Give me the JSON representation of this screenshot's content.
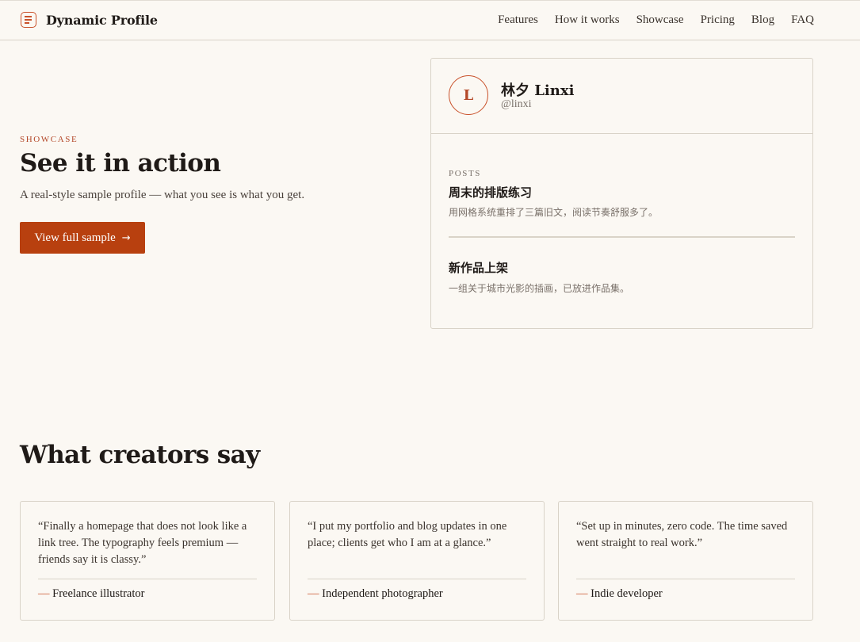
{
  "header": {
    "brand": "Dynamic Profile",
    "nav": [
      "Features",
      "How it works",
      "Showcase",
      "Pricing",
      "Blog",
      "FAQ"
    ]
  },
  "hero": {
    "eyebrow": "SHOWCASE",
    "title": "See it in action",
    "subtitle": "A real-style sample profile — what you see is what you get.",
    "cta_label": "View full sample"
  },
  "profile": {
    "avatar_initial": "L",
    "name": "林夕 Linxi",
    "handle": "@linxi",
    "posts_label": "POSTS",
    "posts": [
      {
        "title": "周末的排版练习",
        "desc": "用网格系统重排了三篇旧文，阅读节奏舒服多了。"
      },
      {
        "title": "新作品上架",
        "desc": "一组关于城市光影的插画，已放进作品集。"
      }
    ]
  },
  "testimonials": {
    "title": "What creators say",
    "items": [
      {
        "quote": "“Finally a homepage that does not look like a link tree. The typography feels premium — friends say it is classy.”",
        "author": "Freelance illustrator"
      },
      {
        "quote": "“I put my portfolio and blog updates in one place; clients get who I am at a glance.”",
        "author": "Independent photographer"
      },
      {
        "quote": "“Set up in minutes, zero code. The time saved went straight to real work.”",
        "author": "Indie developer"
      }
    ]
  },
  "colors": {
    "accent": "#b8400f",
    "background": "#fbf8f3",
    "border": "#d9d3c8"
  }
}
